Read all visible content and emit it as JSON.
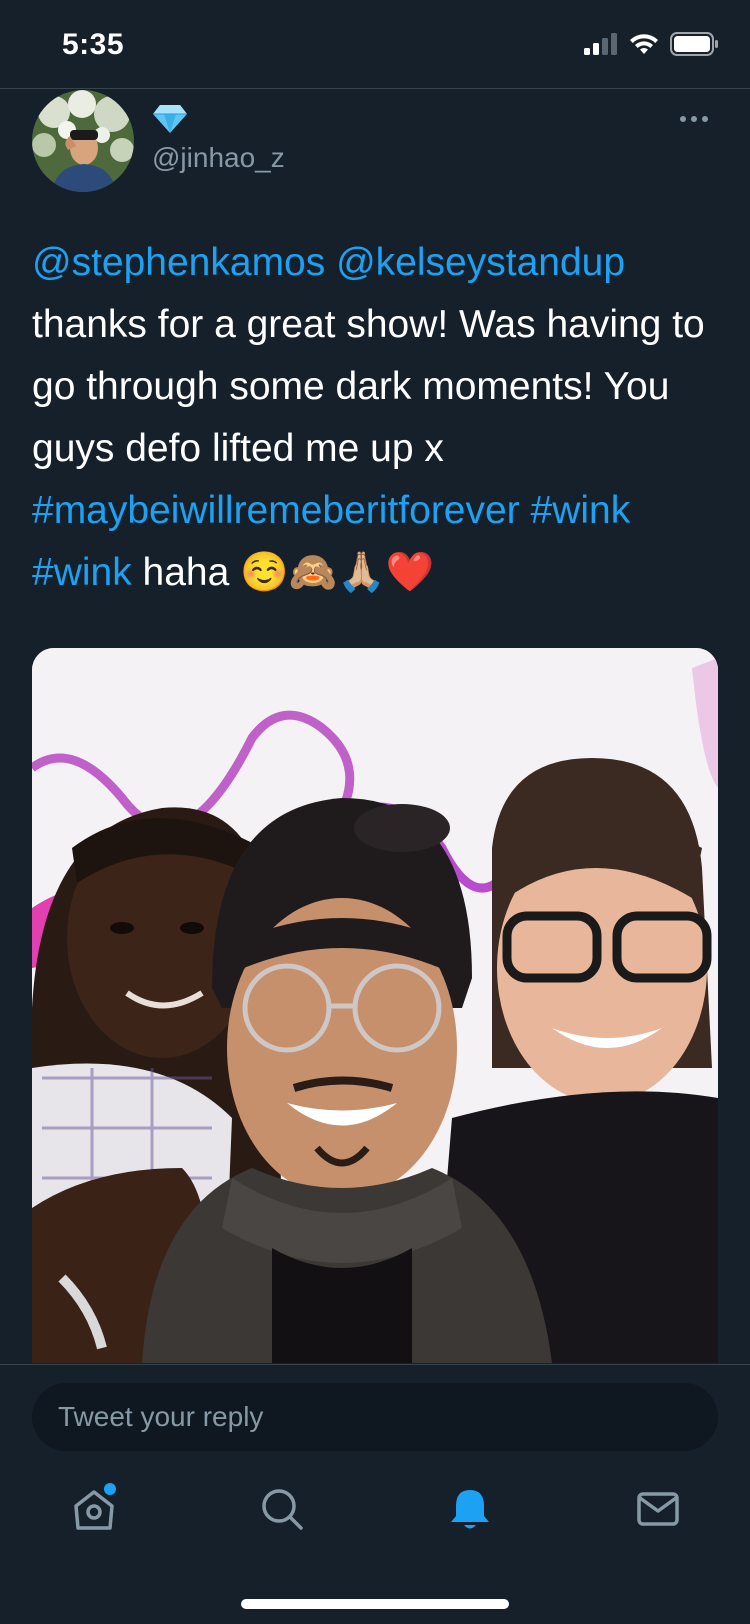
{
  "status_bar": {
    "time": "5:35",
    "icons": [
      "cellular-signal-icon",
      "wifi-icon",
      "battery-icon"
    ]
  },
  "tweet": {
    "author_badge_icon": "diamond-icon",
    "handle": "@jinhao_z",
    "more_icon": "more-horizontal-icon",
    "text_segments": [
      {
        "text": "@stephenkamos",
        "type": "mention"
      },
      {
        "text": " ",
        "type": "plain"
      },
      {
        "text": "@kelseystandup",
        "type": "mention"
      },
      {
        "text": " thanks for a great show!  Was having to go through some dark moments! You guys defo lifted me up x ",
        "type": "plain"
      },
      {
        "text": "#maybeiwillremeberitforever",
        "type": "hashtag"
      },
      {
        "text": " ",
        "type": "plain"
      },
      {
        "text": "#wink",
        "type": "hashtag"
      },
      {
        "text": " ",
        "type": "plain"
      },
      {
        "text": "#wink",
        "type": "hashtag"
      },
      {
        "text": " haha ☺️🙈🙏🏼❤️",
        "type": "plain"
      }
    ]
  },
  "reply": {
    "placeholder": "Tweet your reply"
  },
  "tabs": [
    {
      "name": "home",
      "icon": "home-icon",
      "active": false,
      "has_dot": true
    },
    {
      "name": "search",
      "icon": "search-icon",
      "active": false
    },
    {
      "name": "notifications",
      "icon": "bell-icon",
      "active": true
    },
    {
      "name": "messages",
      "icon": "mail-icon",
      "active": false
    }
  ],
  "colors": {
    "background": "#15202b",
    "link": "#1da1f2",
    "secondary_text": "#8899a6",
    "divider": "#38444d"
  }
}
